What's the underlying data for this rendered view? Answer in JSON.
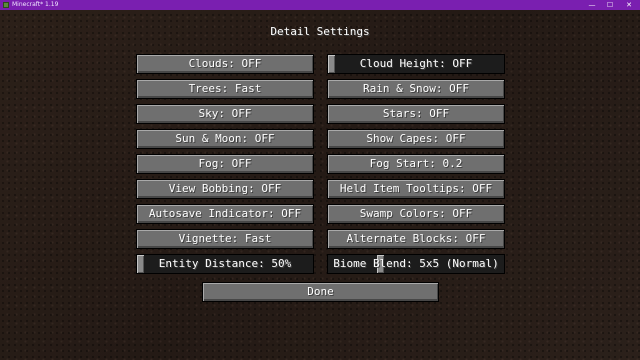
{
  "window": {
    "title": "Minecraft* 1.19",
    "minimize": "—",
    "maximize": "☐",
    "close": "✕"
  },
  "screen": {
    "title": "Detail Settings"
  },
  "left": [
    "Clouds: OFF",
    "Trees: Fast",
    "Sky: OFF",
    "Sun & Moon: OFF",
    "Fog: OFF",
    "View Bobbing: OFF",
    "Autosave Indicator: OFF",
    "Vignette: Fast"
  ],
  "right": [
    "Cloud Height: OFF",
    "Rain & Snow: OFF",
    "Stars: OFF",
    "Show Capes: OFF",
    "Fog Start: 0.2",
    "Held Item Tooltips: OFF",
    "Swamp Colors: OFF",
    "Alternate Blocks: OFF"
  ],
  "sliders": {
    "entity_distance": {
      "label": "Entity Distance: 50%",
      "level": 0.0
    },
    "biome_blend": {
      "label": "Biome Blend: 5x5 (Normal)",
      "level": 0.29
    },
    "cloud_height": {
      "level": 0.0
    }
  },
  "done": "Done"
}
